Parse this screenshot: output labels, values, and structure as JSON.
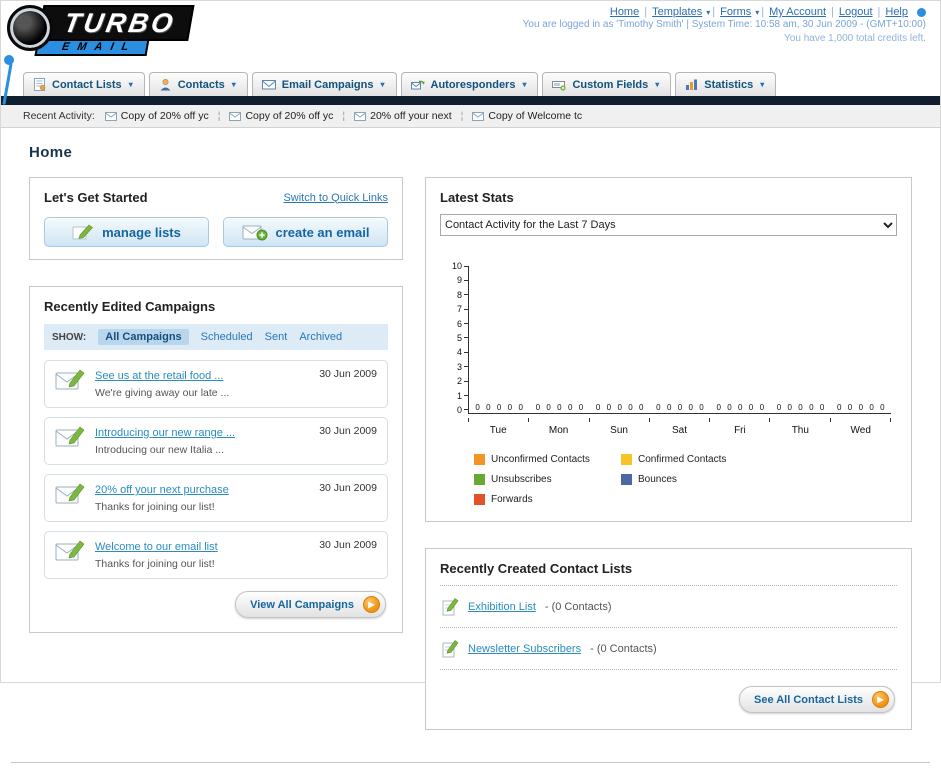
{
  "header": {
    "logo_line1": "TURBO",
    "logo_line2": "EMAIL",
    "links": [
      "Home",
      "Templates",
      "Forms",
      "My Account",
      "Logout",
      "Help"
    ],
    "login_status": "You are logged in as 'Timothy Smith' | System Time: 10:58 am, 30 Jun 2009 - (GMT+10:00)",
    "credits": "You have 1,000 total credits left."
  },
  "nav": {
    "items": [
      {
        "label": "Contact Lists"
      },
      {
        "label": "Contacts"
      },
      {
        "label": "Email Campaigns"
      },
      {
        "label": "Autoresponders"
      },
      {
        "label": "Custom Fields"
      },
      {
        "label": "Statistics"
      }
    ]
  },
  "activity": {
    "label": "Recent Activity:",
    "items": [
      "Copy of 20% off yc",
      "Copy of 20% off yc",
      "20% off your next",
      "Copy of Welcome tc"
    ]
  },
  "page_title": "Home",
  "get_started": {
    "title": "Let's Get Started",
    "switch_link": "Switch to Quick Links",
    "manage_lists_label": "manage lists",
    "create_email_label": "create an email"
  },
  "campaigns": {
    "title": "Recently Edited Campaigns",
    "show_label": "SHOW:",
    "tabs": [
      "All Campaigns",
      "Scheduled",
      "Sent",
      "Archived"
    ],
    "active_tab": "All Campaigns",
    "items": [
      {
        "title": "See us at the retail food ...",
        "subtitle": "We're giving away our late ...",
        "date": "30 Jun 2009"
      },
      {
        "title": "Introducing our new range ...",
        "subtitle": "Introducing our new Italia ...",
        "date": "30 Jun 2009"
      },
      {
        "title": "20% off your next purchase",
        "subtitle": "Thanks for joining our list!",
        "date": "30 Jun 2009"
      },
      {
        "title": "Welcome to our email list",
        "subtitle": "Thanks for joining our list!",
        "date": "30 Jun 2009"
      }
    ],
    "view_all_label": "View All Campaigns"
  },
  "stats": {
    "title": "Latest Stats",
    "dropdown_value": "Contact Activity for the Last 7 Days"
  },
  "chart_data": {
    "type": "bar",
    "title": "Contact Activity for the Last 7 Days",
    "categories": [
      "Tue",
      "Mon",
      "Sun",
      "Sat",
      "Fri",
      "Thu",
      "Wed"
    ],
    "series": [
      {
        "name": "Unconfirmed Contacts",
        "color": "#f59327",
        "values": [
          0,
          0,
          0,
          0,
          0,
          0,
          0
        ]
      },
      {
        "name": "Confirmed Contacts",
        "color": "#f6c424",
        "values": [
          0,
          0,
          0,
          0,
          0,
          0,
          0
        ]
      },
      {
        "name": "Unsubscribes",
        "color": "#67a933",
        "values": [
          0,
          0,
          0,
          0,
          0,
          0,
          0
        ]
      },
      {
        "name": "Bounces",
        "color": "#4a68a2",
        "values": [
          0,
          0,
          0,
          0,
          0,
          0,
          0
        ]
      },
      {
        "name": "Forwards",
        "color": "#e2512a",
        "values": [
          0,
          0,
          0,
          0,
          0,
          0,
          0
        ]
      }
    ],
    "ylim": [
      0,
      10
    ],
    "yticks": [
      0,
      1,
      2,
      3,
      4,
      5,
      6,
      7,
      8,
      9,
      10
    ],
    "grid": false,
    "legend_position": "bottom"
  },
  "contact_lists": {
    "title": "Recently Created Contact Lists",
    "items": [
      {
        "name": "Exhibition List",
        "detail": "- (0 Contacts)"
      },
      {
        "name": "Newsletter Subscribers",
        "detail": "- (0 Contacts)"
      }
    ],
    "see_all_label": "See All Contact Lists"
  }
}
